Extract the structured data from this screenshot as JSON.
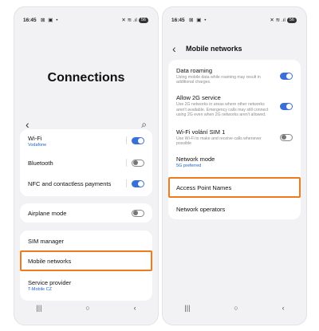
{
  "left_screen": {
    "status": {
      "time": "16:45",
      "icons": "⊠ ▣ •",
      "right_icons": "✕ ≋ .ıl",
      "battery": "56"
    },
    "title": "Connections",
    "back_icon": "‹",
    "search_icon": "⌕",
    "items": {
      "wifi": {
        "label": "Wi-Fi",
        "sub": "Vodafone",
        "state": "on"
      },
      "bluetooth": {
        "label": "Bluetooth",
        "state": "off"
      },
      "nfc": {
        "label": "NFC and contactless payments",
        "state": "on"
      },
      "airplane": {
        "label": "Airplane mode",
        "state": "off"
      },
      "sim": {
        "label": "SIM manager"
      },
      "mobile": {
        "label": "Mobile networks"
      },
      "provider": {
        "label": "Service provider",
        "sub": "T-Mobile CZ"
      }
    },
    "nav": {
      "recents": "|||",
      "home": "○",
      "back": "‹"
    }
  },
  "right_screen": {
    "status": {
      "time": "16:45",
      "icons": "⊠ ▣ •",
      "right_icons": "✕ ≋ .ıl",
      "battery": "56"
    },
    "header": "Mobile networks",
    "back_icon": "‹",
    "items": {
      "roaming": {
        "label": "Data roaming",
        "desc": "Using mobile data while roaming may result in additional charges.",
        "state": "on"
      },
      "allow2g": {
        "label": "Allow 2G service",
        "desc": "Use 2G networks in areas where other networks aren't available. Emergency calls may still connect using 2G even when 2G networks aren't allowed.",
        "state": "on"
      },
      "wifi_calling": {
        "label": "Wi-Fi volání SIM 1",
        "desc": "Use Wi-Fi to make and receive calls whenever possible",
        "state": "off"
      },
      "network_mode": {
        "label": "Network mode",
        "sub": "5G preferred"
      },
      "apn": {
        "label": "Access Point Names"
      },
      "operators": {
        "label": "Network operators"
      }
    },
    "nav": {
      "recents": "|||",
      "home": "○",
      "back": "‹"
    }
  },
  "colors": {
    "highlight": "#f07b1d",
    "toggle_on": "#3a6fd8",
    "link_sub": "#1b63c8"
  }
}
